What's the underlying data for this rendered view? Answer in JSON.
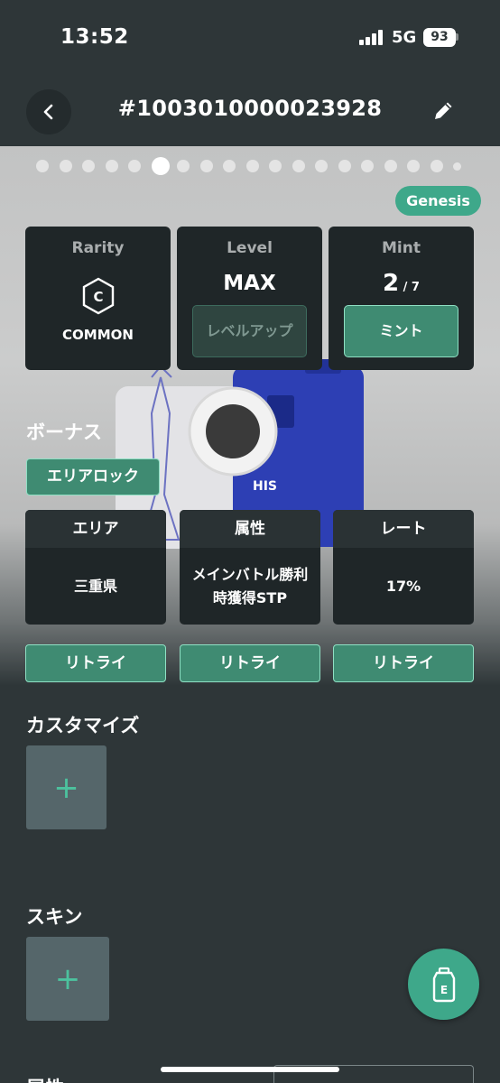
{
  "status_bar": {
    "time": "13:52",
    "network": "5G",
    "battery": "93"
  },
  "header": {
    "title": "#1003010000023928"
  },
  "carousel": {
    "total": 19,
    "active_index": 5
  },
  "badge": {
    "label": "Genesis"
  },
  "stats": {
    "rarity": {
      "label": "Rarity",
      "icon": "C",
      "value": "COMMON"
    },
    "level": {
      "label": "Level",
      "value": "MAX",
      "button": "レベルアップ"
    },
    "mint": {
      "label": "Mint",
      "count": "2",
      "separator": " / ",
      "max": "7",
      "button": "ミント"
    }
  },
  "bonus": {
    "title": "ボーナス",
    "tag": "エリアロック",
    "columns": [
      {
        "header": "エリア",
        "value": "三重県"
      },
      {
        "header": "属性",
        "value": "メインバトル勝利時獲得STP"
      },
      {
        "header": "レート",
        "value": "17%"
      }
    ],
    "retry_label": "リトライ"
  },
  "customize": {
    "title": "カスタマイズ",
    "add": "+"
  },
  "skin": {
    "title": "スキン",
    "add": "+"
  },
  "next_section": {
    "title": "属性"
  },
  "colors": {
    "accent": "#3ea88a",
    "background": "#2e3638",
    "card": "#1f2628"
  }
}
